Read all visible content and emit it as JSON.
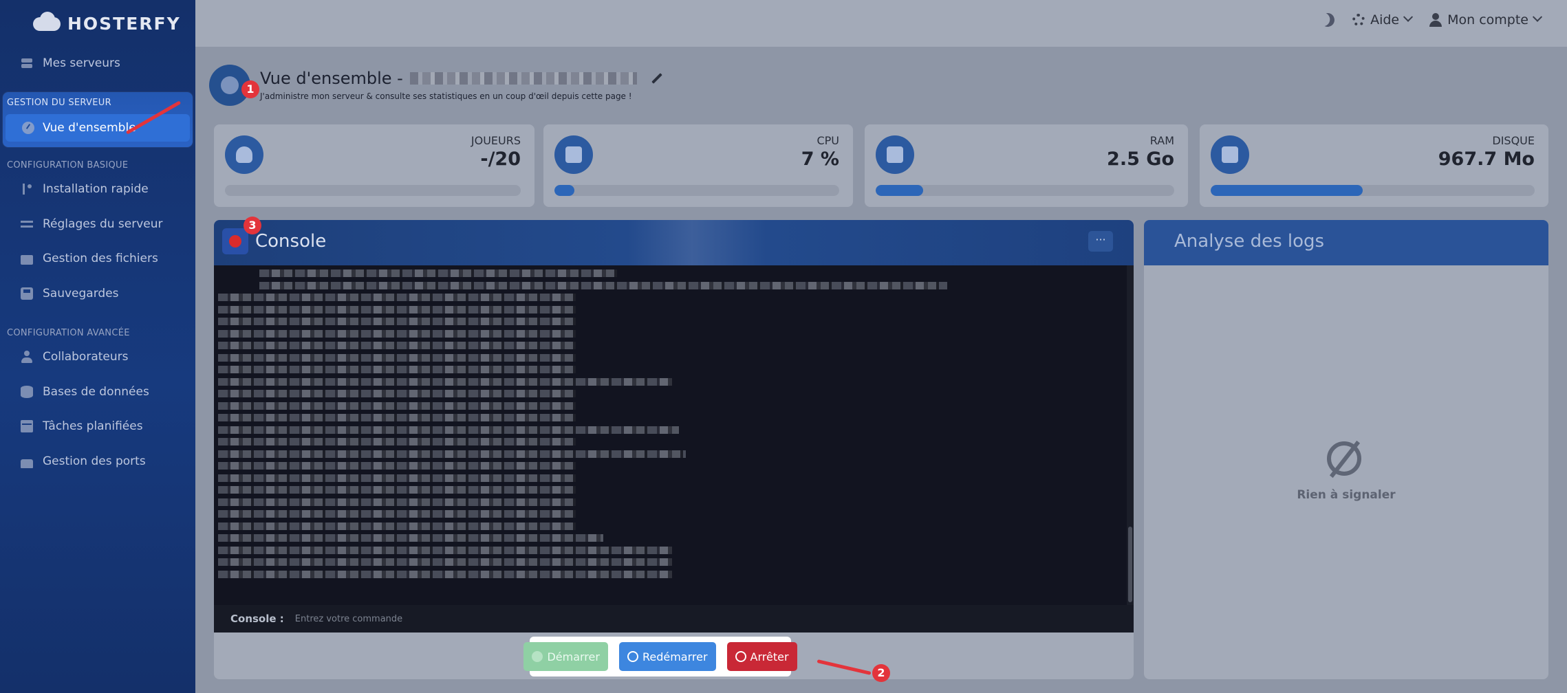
{
  "brand": {
    "name": "HOSTERFY"
  },
  "sidebar": {
    "top_item": {
      "label": "Mes serveurs",
      "icon": "server-icon"
    },
    "sections": [
      {
        "title": "GESTION DU SERVEUR",
        "items": [
          {
            "label": "Vue d'ensemble",
            "icon": "gauge-icon",
            "active": true
          }
        ]
      },
      {
        "title": "CONFIGURATION BASIQUE",
        "items": [
          {
            "label": "Installation rapide",
            "icon": "code-branch-icon"
          },
          {
            "label": "Réglages du serveur",
            "icon": "sliders-icon"
          },
          {
            "label": "Gestion des fichiers",
            "icon": "folder-icon"
          },
          {
            "label": "Sauvegardes",
            "icon": "save-icon"
          }
        ]
      },
      {
        "title": "CONFIGURATION AVANCÉE",
        "items": [
          {
            "label": "Collaborateurs",
            "icon": "users-icon"
          },
          {
            "label": "Bases de données",
            "icon": "database-icon"
          },
          {
            "label": "Tâches planifiées",
            "icon": "calendar-clock-icon"
          },
          {
            "label": "Gestion des ports",
            "icon": "ethernet-icon"
          }
        ]
      }
    ]
  },
  "topbar": {
    "help_label": "Aide",
    "account_label": "Mon compte"
  },
  "header": {
    "title": "Vue d'ensemble -",
    "subtitle": "J'administre mon serveur & consulte ses statistiques en un coup d'œil depuis cette page !"
  },
  "stats": [
    {
      "label": "JOUEURS",
      "value": "-/20",
      "progress": 0,
      "icon": "user-icon"
    },
    {
      "label": "CPU",
      "value": "7 %",
      "progress": 0.07,
      "icon": "microchip-icon"
    },
    {
      "label": "RAM",
      "value": "2.5 Go",
      "progress": 0.16,
      "icon": "memory-icon"
    },
    {
      "label": "DISQUE",
      "value": "967.7 Mo",
      "progress": 0.47,
      "icon": "hard-drive-icon"
    }
  ],
  "console": {
    "title": "Console",
    "more_label": "···",
    "input_label": "Console :",
    "input_placeholder": "Entrez votre commande"
  },
  "actions": {
    "start_label": "Démarrer",
    "restart_label": "Redémarrer",
    "stop_label": "Arrêter"
  },
  "logs": {
    "title": "Analyse des logs",
    "empty_text": "Rien à signaler"
  },
  "annotations": [
    "1",
    "2",
    "3"
  ],
  "colors": {
    "accent": "#2f6fd6",
    "danger": "#c92836",
    "success": "#8fd0a4",
    "annotation": "#e3343b"
  }
}
